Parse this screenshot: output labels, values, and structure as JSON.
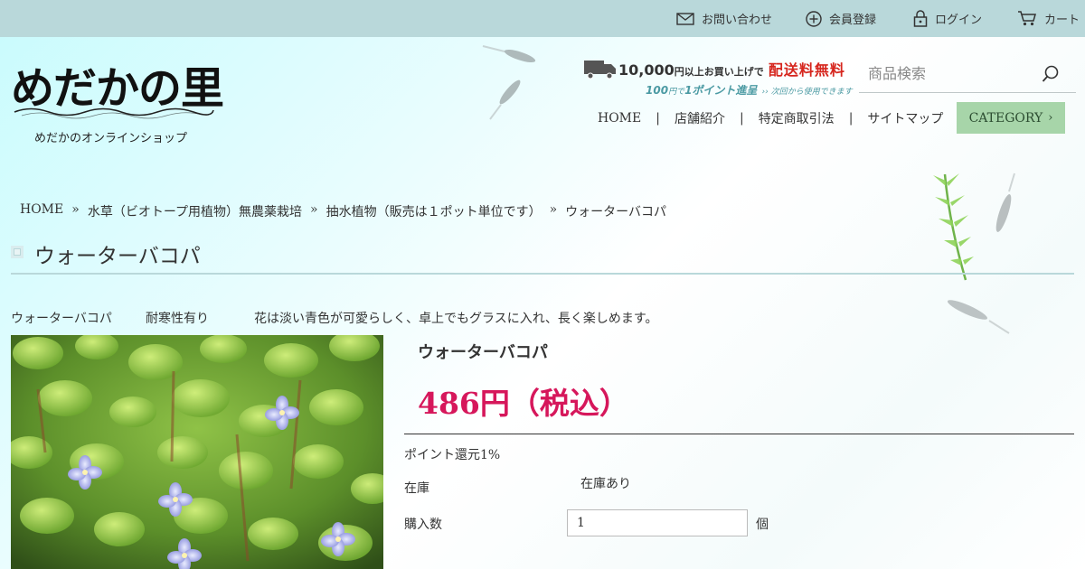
{
  "header": {
    "utility": [
      {
        "label": "お問い合わせ",
        "icon": "mail-icon"
      },
      {
        "label": "会員登録",
        "icon": "plus-circle-icon"
      },
      {
        "label": "ログイン",
        "icon": "lock-icon"
      },
      {
        "label": "カート",
        "icon": "cart-icon"
      }
    ],
    "logo": {
      "title": "めだかの里",
      "subtitle": "めだかのオンラインショップ"
    },
    "shipping": {
      "amount": "10,000",
      "amount_suffix": "円以上お買い上げで",
      "free_shipping": "配送料無料",
      "points_amount": "100",
      "points_mid": "円で",
      "points_value": "1ポイント進呈",
      "points_note": "›› 次回から使用できます"
    },
    "search": {
      "placeholder": "商品検索"
    },
    "nav": [
      "HOME",
      "店舗紹介",
      "特定商取引法",
      "サイトマップ"
    ],
    "nav_separator": "|",
    "category_label": "CATEGORY"
  },
  "breadcrumb": {
    "items": [
      "HOME",
      "水草（ビオトープ用植物）無農薬栽培",
      "抽水植物（販売は１ポット単位です）",
      "ウォーターバコパ"
    ],
    "separator": "»"
  },
  "product": {
    "page_title": "ウォーターバコパ",
    "description": [
      "ウォーターバコパ",
      "耐寒性有り",
      "花は淡い青色が可愛らしく、卓上でもグラスに入れ、長く楽しめます。"
    ],
    "name": "ウォーターバコパ",
    "price": "486円（税込）",
    "points": "ポイント還元1%",
    "stock_label": "在庫",
    "stock_value": "在庫あり",
    "qty_label": "購入数",
    "qty_value": "1",
    "qty_unit": "個"
  },
  "colors": {
    "topbar": "#b9d8da",
    "price": "#d6175b",
    "category_button": "#a7d5a9",
    "free_shipping": "#d6261e"
  }
}
